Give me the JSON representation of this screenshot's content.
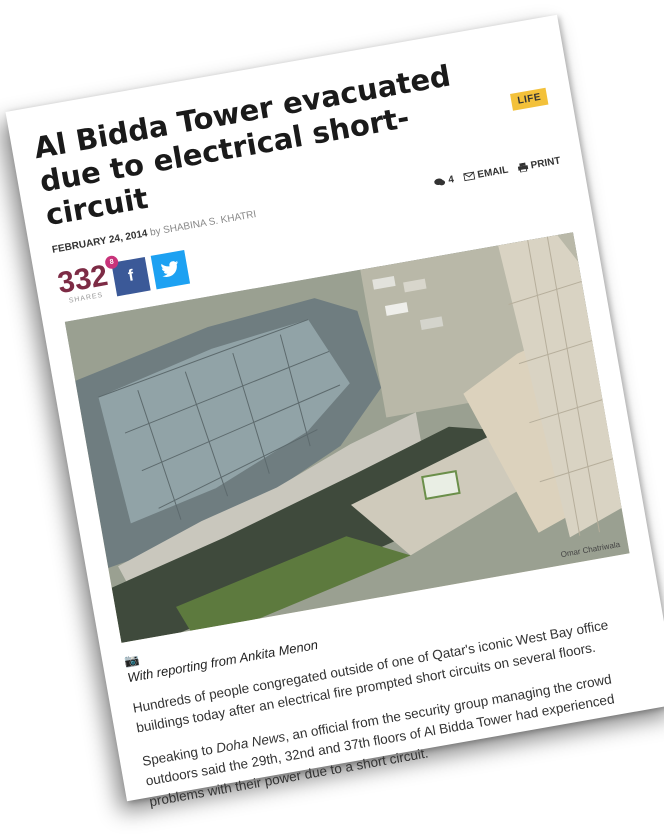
{
  "article": {
    "title": "Al Bidda Tower evacuated due to electrical short-circuit",
    "category": "LIFE",
    "date": "FEBRUARY 24, 2014",
    "by": "by",
    "author": "SHABINA S. KHATRI",
    "comments_count": "4",
    "email_label": "EMAIL",
    "print_label": "PRINT"
  },
  "shares": {
    "count": "332",
    "label": "SHARES",
    "facebook_glyph": "f",
    "badge": "8"
  },
  "photo": {
    "credit": "Omar Chatriwala"
  },
  "body": {
    "caption": "With reporting from Ankita Menon",
    "para1": "Hundreds of people congregated outside of one of Qatar's iconic West Bay office buildings today after an electrical fire prompted short circuits on several floors.",
    "para2_pre": "Speaking to ",
    "para2_em": "Doha News",
    "para2_post": ", an official from the security group managing the crowd outdoors said the 29th, 32nd and 37th floors of Al Bidda Tower had experienced problems with their power due to a short circuit."
  },
  "colors": {
    "share_count": "#7d2b45",
    "facebook": "#3b5998",
    "twitter": "#1da1f2",
    "tag_bg": "#f3c13a"
  }
}
